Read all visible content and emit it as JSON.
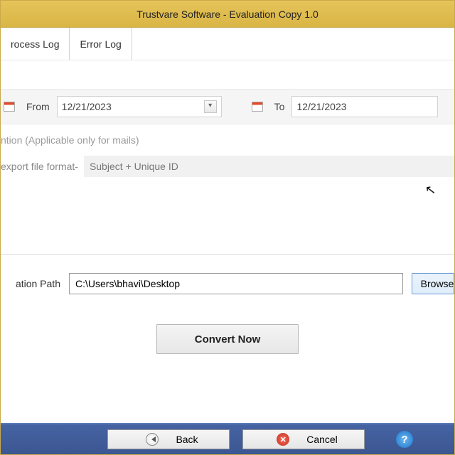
{
  "title": "Trustvare Software - Evaluation Copy 1.0",
  "tabs": {
    "process_log": "rocess Log",
    "error_log": "Error Log"
  },
  "date": {
    "from_label": "From",
    "from_value": "12/21/2023",
    "to_label": "To",
    "to_value": "12/21/2023"
  },
  "note": "ntion (Applicable only for mails)",
  "format": {
    "label": "export file format-",
    "value": "Subject + Unique ID"
  },
  "dest": {
    "label": "ation Path",
    "value": "C:\\Users\\bhavi\\Desktop",
    "browse": "Browse"
  },
  "convert": "Convert Now",
  "footer": {
    "back": "Back",
    "cancel": "Cancel"
  }
}
